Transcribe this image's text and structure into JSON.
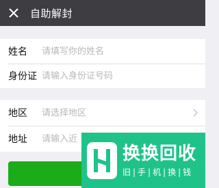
{
  "header": {
    "title": "自助解封",
    "close_icon": "close-icon"
  },
  "form": {
    "name": {
      "label": "姓名",
      "placeholder": "请填写你的姓名"
    },
    "id_card": {
      "label": "身份证",
      "placeholder": "请输入身份证号码"
    },
    "region": {
      "label": "地区",
      "placeholder": "请选择地区"
    },
    "address": {
      "label": "地址",
      "placeholder": "请输入近"
    }
  },
  "watermark": {
    "title": "换换回收",
    "subtitle": "旧|手|机|换|钱"
  },
  "colors": {
    "header_bg": "#3d3d42",
    "button_green": "#1aad19",
    "watermark_bg": "#1fc38a"
  }
}
